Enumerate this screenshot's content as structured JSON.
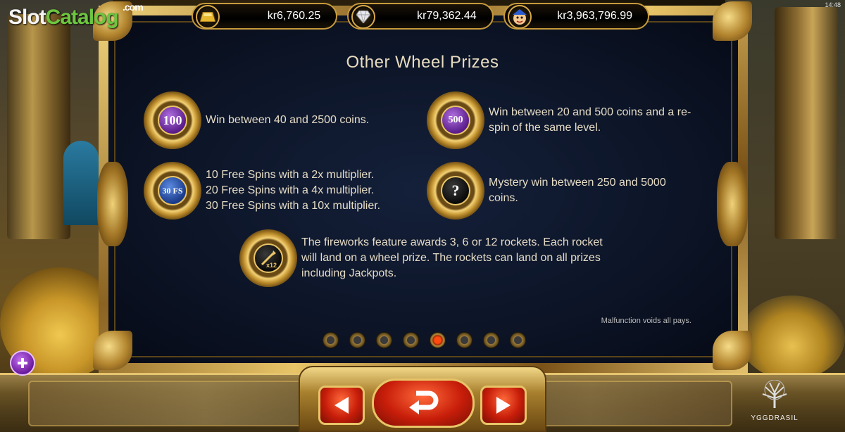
{
  "brand": {
    "slot": "Slot",
    "catalog": "Catalog",
    "com": ".com"
  },
  "clock": "14:48",
  "jackpots": [
    {
      "icon": "gold-bar-icon",
      "value": "kr6,760.25"
    },
    {
      "icon": "diamond-icon",
      "value": "kr79,362.44"
    },
    {
      "icon": "jester-face-icon",
      "value": "kr3,963,796.99"
    }
  ],
  "page": {
    "title": "Other Wheel Prizes",
    "prizes": [
      {
        "symbol": "100",
        "text": "Win between 40 and 2500 coins."
      },
      {
        "symbol": "500",
        "text": "Win between 20 and 500 coins and a re-spin of the same level."
      },
      {
        "symbol": "30 FS",
        "text_lines": [
          "10 Free Spins with a 2x multiplier.",
          "20 Free Spins with a 4x multiplier.",
          "30 Free Spins with a 10x multiplier."
        ]
      },
      {
        "symbol": "?",
        "text": "Mystery win between 250 and 5000 coins."
      },
      {
        "symbol": "x12",
        "text": "The fireworks feature awards 3, 6 or 12 rockets. Each rocket will land on a wheel prize. The rockets can land on all prizes including Jackpots."
      }
    ],
    "malfunction": "Malfunction voids all pays.",
    "pagination": {
      "total": 8,
      "active": 5
    }
  },
  "footer": {
    "provider": "YGGDRASIL"
  },
  "colors": {
    "accent_gold": "#c79a3c",
    "button_red": "#c81e0a",
    "panel_bg": "#0c1426",
    "active_dot": "#ff4a10"
  }
}
